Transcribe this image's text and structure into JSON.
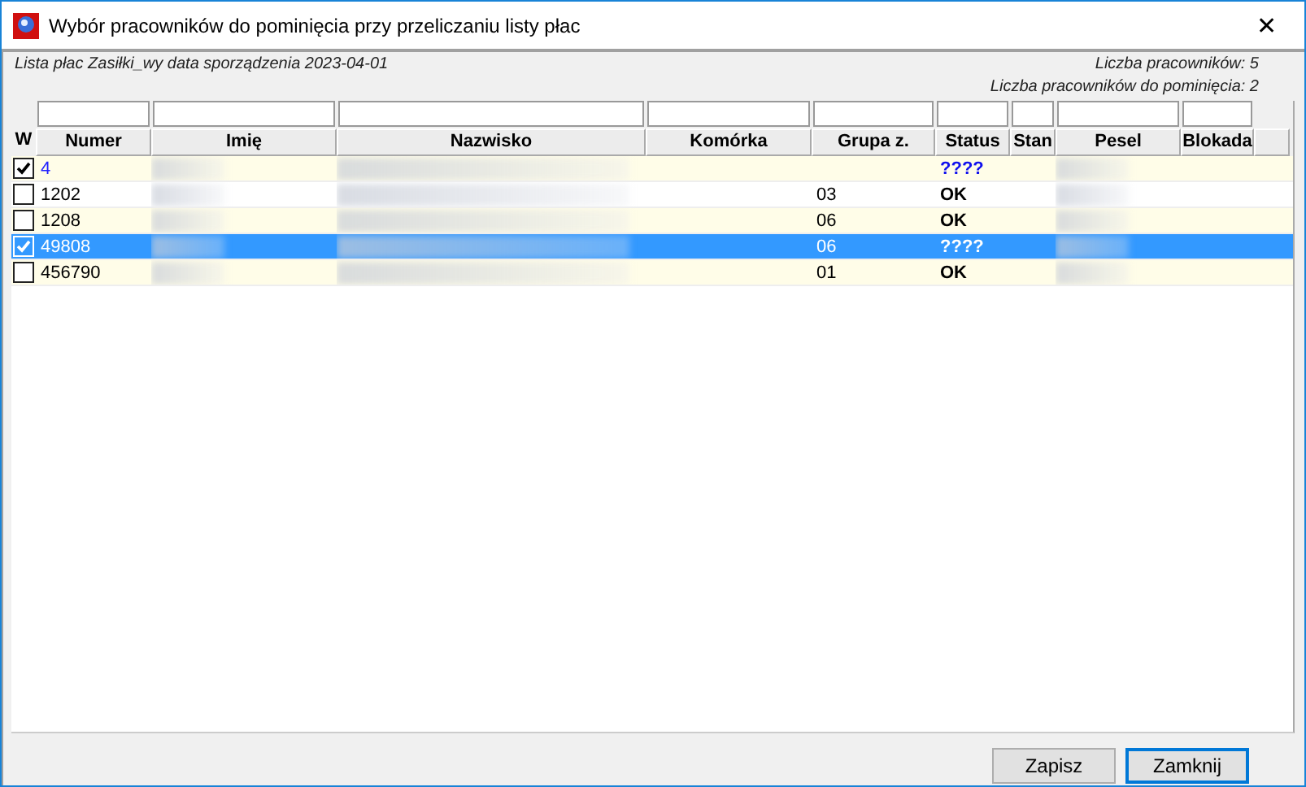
{
  "window": {
    "title": "Wybór pracowników do pominięcia przy przeliczaniu listy płac",
    "close": "✕"
  },
  "info": {
    "list": "Lista płac Zasiłki_wy data sporządzenia 2023-04-01",
    "count": "Liczba pracowników: 5",
    "skip_count": "Liczba pracowników do pominięcia: 2"
  },
  "table": {
    "columns": [
      "W",
      "Numer",
      "Imię",
      "Nazwisko",
      "Komórka",
      "Grupa z.",
      "Status",
      "Stan",
      "Pesel",
      "Blokada"
    ],
    "rows": [
      {
        "checked": true,
        "selected": false,
        "kind": "unknown",
        "numer": "4",
        "grupa": "",
        "status": "????"
      },
      {
        "checked": false,
        "selected": false,
        "kind": "ok",
        "numer": "1202",
        "grupa": "03",
        "status": "OK"
      },
      {
        "checked": false,
        "selected": false,
        "kind": "ok",
        "numer": "1208",
        "grupa": "06",
        "status": "OK"
      },
      {
        "checked": true,
        "selected": true,
        "kind": "unknown",
        "numer": "49808",
        "grupa": "06",
        "status": "????"
      },
      {
        "checked": false,
        "selected": false,
        "kind": "ok",
        "numer": "456790",
        "grupa": "01",
        "status": "OK"
      }
    ]
  },
  "buttons": [
    {
      "label": "Zapisz",
      "default": false
    },
    {
      "label": "Zamknij",
      "default": true
    }
  ]
}
